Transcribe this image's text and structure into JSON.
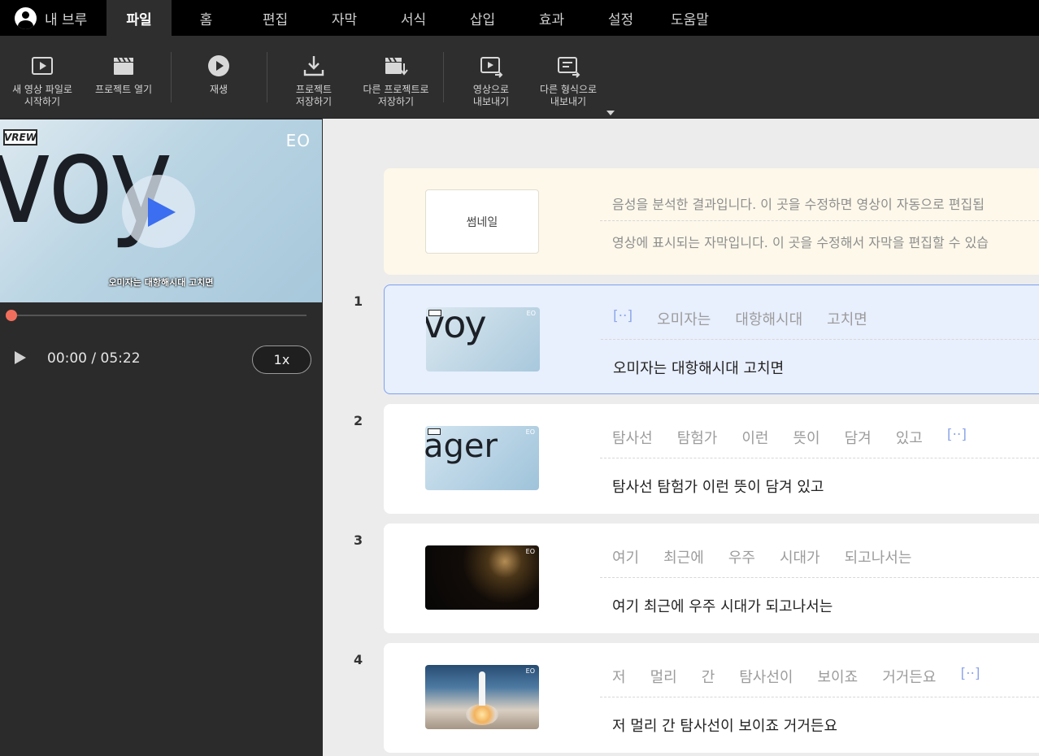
{
  "menubar": {
    "account_label": "내 브루",
    "tabs": [
      "파일",
      "홈",
      "편집",
      "자막",
      "서식",
      "삽입",
      "효과",
      "설정",
      "도움말"
    ],
    "active_tab": "파일"
  },
  "toolbar": {
    "new_video": "새 영상 파일로\n시작하기",
    "open_project": "프로젝트 열기",
    "play": "재생",
    "save_project": "프로젝트\n저장하기",
    "save_as": "다른 프로젝트로\n저장하기",
    "export_video": "영상으로\n내보내기",
    "export_other": "다른 형식으로\n내보내기"
  },
  "player": {
    "logo_text": "VREW",
    "channel_mark": "EO",
    "frame_text": "voy",
    "caption": "오미자는 대항해시대 고치면",
    "time": "00:00 / 05:22",
    "speed": "1x",
    "progress": 0
  },
  "editor": {
    "header": {
      "thumb_label": "썸네일",
      "line1": "음성을 분석한 결과입니다. 이 곳을 수정하면 영상이 자동으로 편집됩",
      "line2": "영상에 표시되는 자막입니다. 이 곳을 수정해서 자막을 편집할 수 있습"
    },
    "clips": [
      {
        "num": "1",
        "frame_text": "voy",
        "words": [
          "[··]",
          "오미자는",
          "대항해시대",
          "고치면"
        ],
        "subtitle": "오미자는 대항해시대 고치면"
      },
      {
        "num": "2",
        "frame_text": "ager",
        "words": [
          "탐사선",
          "탐험가",
          "이런",
          "뜻이",
          "담겨",
          "있고",
          "[··]"
        ],
        "subtitle": "탐사선 탐험가 이런 뜻이 담겨 있고"
      },
      {
        "num": "3",
        "frame_text": "",
        "words": [
          "여기",
          "최근에",
          "우주",
          "시대가",
          "되고나서는"
        ],
        "subtitle": "여기 최근에 우주 시대가 되고나서는"
      },
      {
        "num": "4",
        "frame_text": "",
        "words": [
          "저",
          "멀리",
          "간",
          "탐사선이",
          "보이죠",
          "거거든요",
          "[··]"
        ],
        "subtitle": "저 멀리 간 탐사선이 보이죠 거거든요"
      }
    ]
  }
}
